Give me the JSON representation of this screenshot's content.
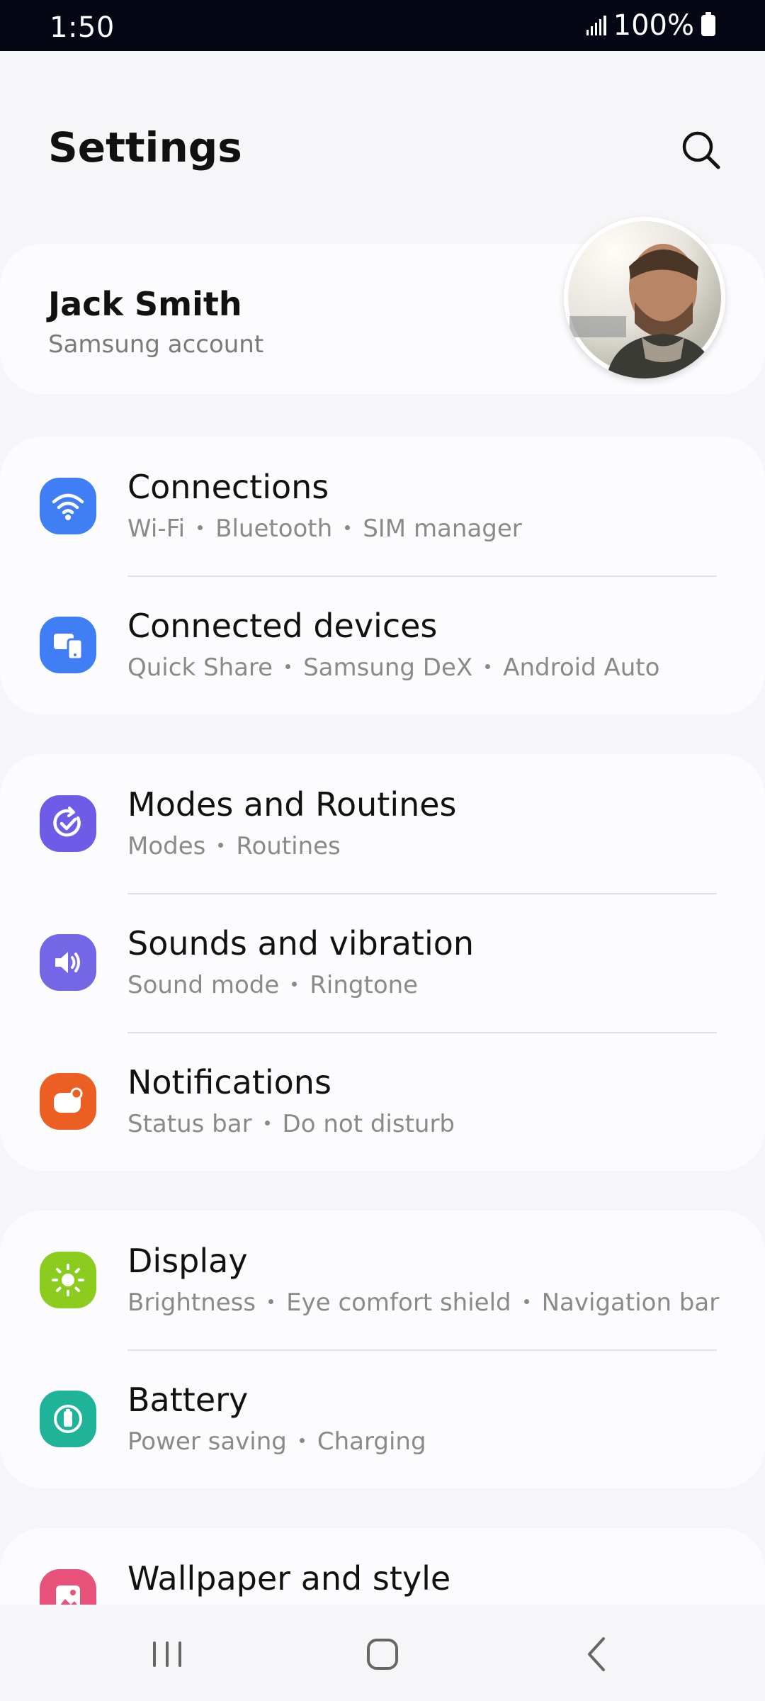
{
  "status_bar": {
    "time": "1:50",
    "battery_text": "100%"
  },
  "header": {
    "title": "Settings",
    "search_icon": "search-icon"
  },
  "profile": {
    "name": "Jack Smith",
    "subtitle": "Samsung account"
  },
  "groups": [
    {
      "items": [
        {
          "title": "Connections",
          "subs": [
            "Wi-Fi",
            "Bluetooth",
            "SIM manager"
          ],
          "icon": "wifi-icon",
          "color": "#3f7ef5"
        },
        {
          "title": "Connected devices",
          "subs": [
            "Quick Share",
            "Samsung DeX",
            "Android Auto"
          ],
          "icon": "devices-icon",
          "color": "#3f7ef5"
        }
      ]
    },
    {
      "items": [
        {
          "title": "Modes and Routines",
          "subs": [
            "Modes",
            "Routines"
          ],
          "icon": "routine-check-icon",
          "color": "#6e5ce6"
        },
        {
          "title": "Sounds and vibration",
          "subs": [
            "Sound mode",
            "Ringtone"
          ],
          "icon": "speaker-icon",
          "color": "#7467e6"
        },
        {
          "title": "Notifications",
          "subs": [
            "Status bar",
            "Do not disturb"
          ],
          "icon": "notification-icon",
          "color": "#ec5f23"
        }
      ]
    },
    {
      "items": [
        {
          "title": "Display",
          "subs": [
            "Brightness",
            "Eye comfort shield",
            "Navigation bar"
          ],
          "icon": "sun-icon",
          "color": "#8ccc1f"
        },
        {
          "title": "Battery",
          "subs": [
            "Power saving",
            "Charging"
          ],
          "icon": "battery-icon",
          "color": "#1fb39a"
        }
      ]
    },
    {
      "items": [
        {
          "title": "Wallpaper and style",
          "subs": [],
          "icon": "wallpaper-icon",
          "color": "#e8527a"
        }
      ]
    }
  ],
  "nav": {
    "recents_icon": "recents-icon",
    "home_icon": "home-icon",
    "back_icon": "back-icon"
  }
}
